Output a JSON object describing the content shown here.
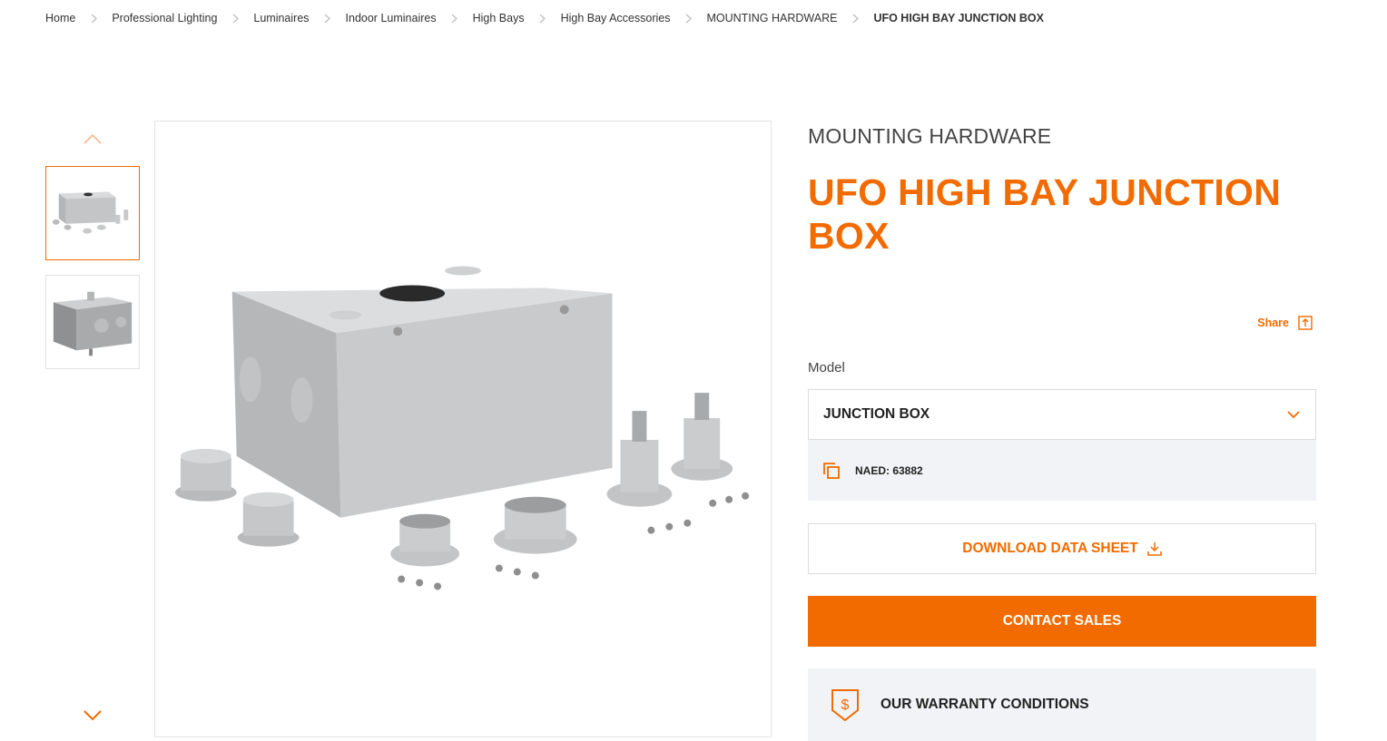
{
  "breadcrumb": [
    {
      "label": "Home"
    },
    {
      "label": "Professional Lighting"
    },
    {
      "label": "Luminaires"
    },
    {
      "label": "Indoor Luminaires"
    },
    {
      "label": "High Bays"
    },
    {
      "label": "High Bay Accessories"
    },
    {
      "label": "MOUNTING HARDWARE"
    },
    {
      "label": "UFO HIGH BAY JUNCTION BOX"
    }
  ],
  "product": {
    "category": "MOUNTING HARDWARE",
    "title": "UFO HIGH BAY JUNCTION BOX"
  },
  "share": {
    "label": "Share",
    "icon": "share-icon"
  },
  "model": {
    "label": "Model",
    "selected": "JUNCTION BOX",
    "icon": "chevron-down-icon"
  },
  "naed": {
    "text": "NAED: 63882",
    "icon": "copy-icon"
  },
  "download": {
    "label": "DOWNLOAD DATA SHEET",
    "icon": "download-icon"
  },
  "contact": {
    "label": "CONTACT SALES"
  },
  "warranty": {
    "label": "OUR WARRANTY CONDITIONS",
    "icon": "shield-dollar-icon"
  },
  "gallery": {
    "thumbnails": [
      {
        "name": "junction-box-with-accessories",
        "active": true
      },
      {
        "name": "junction-box-side-view",
        "active": false
      }
    ]
  },
  "colors": {
    "accent": "#f26b00",
    "panel": "#f1f3f6",
    "border": "#dcdcdc"
  }
}
